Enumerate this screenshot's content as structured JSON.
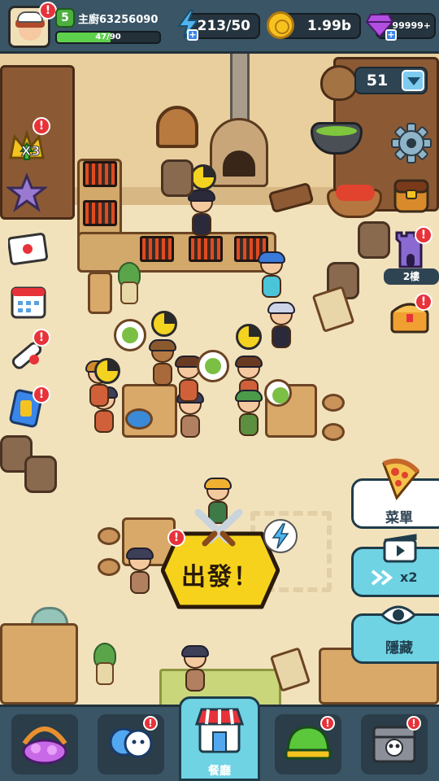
{
  "hud": {
    "level": "5",
    "player_name": "主廚63256090",
    "xp_text": "47/90",
    "xp_progress": 0.52,
    "energy": "213/50",
    "coins": "1.99b",
    "gems": "99999+"
  },
  "side_left": {
    "multiplier_label": "X3"
  },
  "side_right": {
    "ingredient_count": "51",
    "floor_label": "2樓"
  },
  "actions": {
    "menu_label": "菜單",
    "speed_label": "x2",
    "hide_label": "隱藏",
    "go_label": "出發！"
  },
  "nav": {
    "active_label": "餐廳"
  },
  "colors": {
    "hud_bg": "#3a5566",
    "badge_red": "#e8323a",
    "accent_cyan": "#6fd3e4",
    "go_yellow": "#f6d21c"
  },
  "icons": {
    "energy": "lightning-icon",
    "coin": "coin-icon",
    "gem": "gem-icon",
    "settings": "gear-icon",
    "inventory": "backpack-icon",
    "castle": "tower-icon",
    "chest": "treasure-chest-icon",
    "mail": "envelope-icon",
    "calendar": "calendar-icon",
    "scroll": "scroll-icon",
    "drink": "drink-card-icon",
    "star": "star-icon",
    "menu": "pizza-icon",
    "speed": "video-icon",
    "hide": "eye-icon",
    "go": "crossed-swords-icon"
  }
}
